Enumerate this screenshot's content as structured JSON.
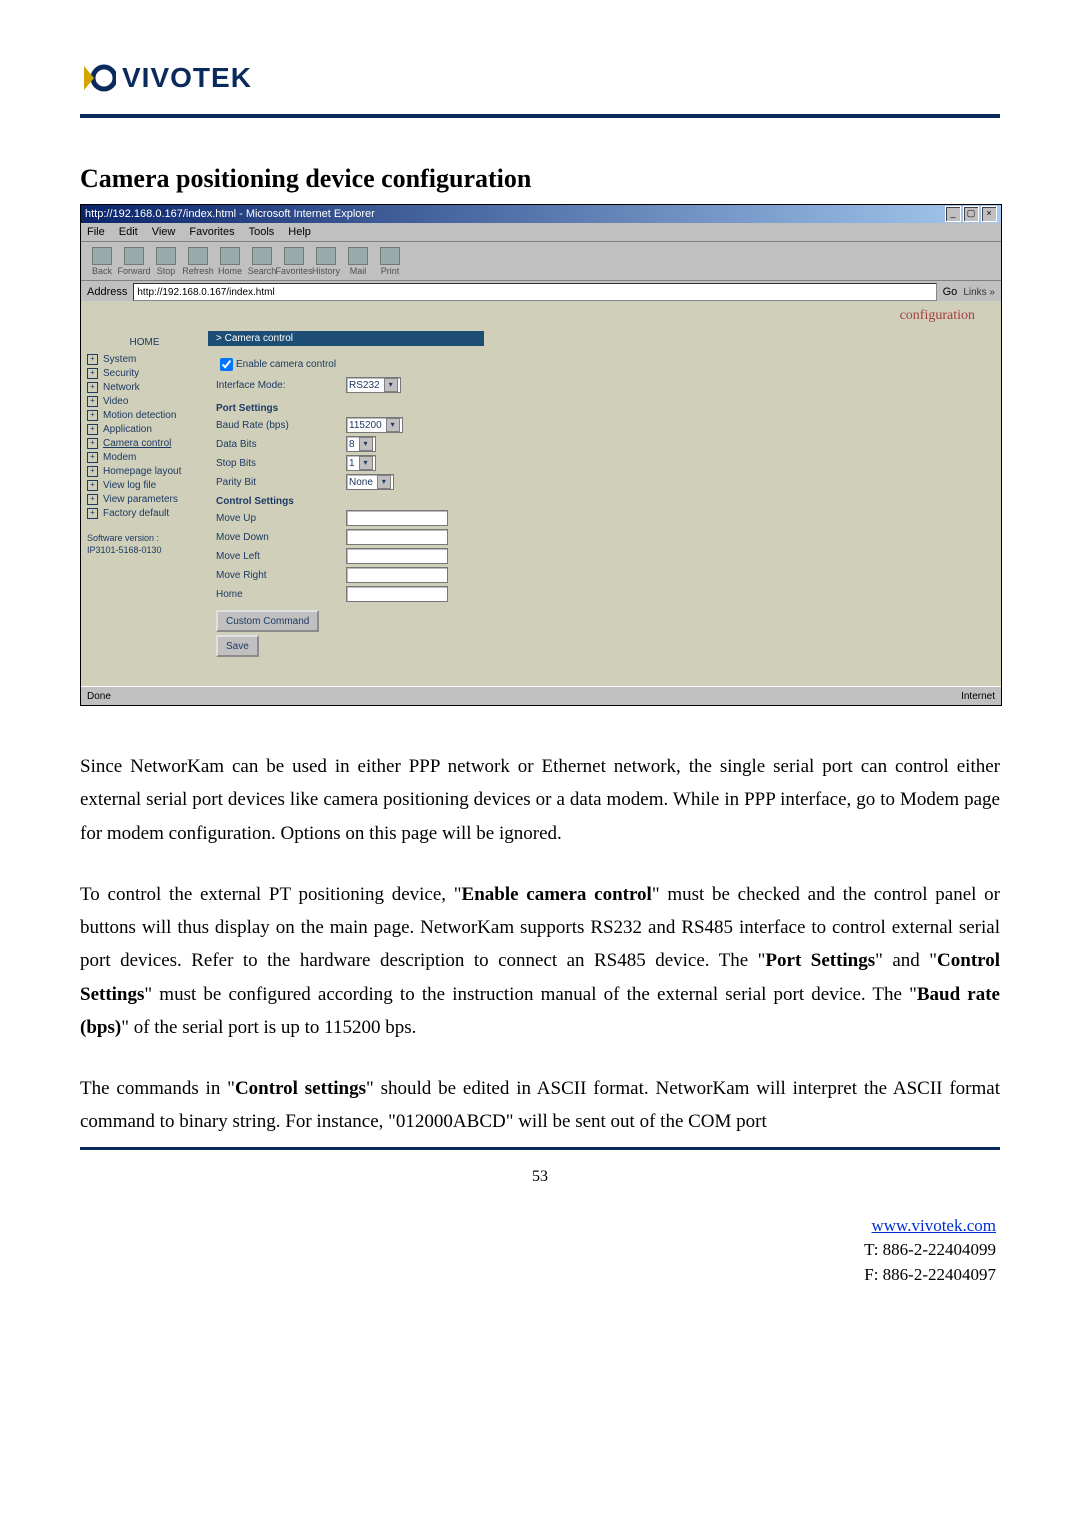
{
  "logo_text": "VIVOTEK",
  "heading": "Camera positioning device configuration",
  "ie": {
    "title": "http://192.168.0.167/index.html - Microsoft Internet Explorer",
    "menu": {
      "file": "File",
      "edit": "Edit",
      "view": "View",
      "favorites": "Favorites",
      "tools": "Tools",
      "help": "Help"
    },
    "toolbar": {
      "back": "Back",
      "forward": "Forward",
      "stop": "Stop",
      "refresh": "Refresh",
      "home": "Home",
      "search": "Search",
      "favorites": "Favorites",
      "history": "History",
      "mail": "Mail",
      "print": "Print"
    },
    "address_label": "Address",
    "address_value": "http://192.168.0.167/index.html",
    "go": "Go",
    "links": "Links »",
    "status_left": "Done",
    "status_right": "Internet"
  },
  "conf": {
    "page_label": "configuration",
    "sidebar": {
      "home": "HOME",
      "items": [
        "System",
        "Security",
        "Network",
        "Video",
        "Motion detection",
        "Application",
        "Camera control",
        "Modem",
        "Homepage layout",
        "View log file",
        "View parameters",
        "Factory default"
      ],
      "sw1": "Software version :",
      "sw2": "IP3101-5168-0130"
    },
    "panel": {
      "title": "> Camera control",
      "enable": "Enable camera control",
      "iface_label": "Interface Mode:",
      "iface_value": "RS232",
      "port_heading": "Port Settings",
      "baud_label": "Baud Rate (bps)",
      "baud_value": "115200",
      "data_label": "Data Bits",
      "data_value": "8",
      "stop_label": "Stop Bits",
      "stop_value": "1",
      "parity_label": "Parity Bit",
      "parity_value": "None",
      "ctrl_heading": "Control Settings",
      "mu": "Move Up",
      "md": "Move Down",
      "ml": "Move Left",
      "mr": "Move Right",
      "home_cmd": "Home",
      "custom_btn": "Custom Command",
      "save_btn": "Save"
    }
  },
  "paragraphs": {
    "p1": "Since NetworKam can be used in either PPP network or Ethernet network, the single serial port can control either external serial port devices like camera positioning devices or a data modem. While in PPP interface, go to Modem page for modem configuration. Options on this page will be ignored.",
    "p2a": "To control the external PT positioning device, \"",
    "p2b": "Enable camera control",
    "p2c": "\" must be checked and the control panel or buttons will thus display on the main page. NetworKam supports RS232 and RS485 interface to control external serial port devices. Refer to the hardware description to connect an RS485 device. The \"",
    "p2d": "Port Settings",
    "p2e": "\" and \"",
    "p2f": "Control Settings",
    "p2g": "\" must be configured according to the instruction manual of the external serial port device. The \"",
    "p2h": "Baud rate (bps)",
    "p2i": "\" of the serial port is up to 115200 bps.",
    "p3a": "The commands in \"",
    "p3b": "Control settings",
    "p3c": "\" should be edited in ASCII format. NetworKam will interpret the ASCII format command to binary string. For instance, \"012000ABCD\" will be sent out of the COM port"
  },
  "page_number": "53",
  "footer": {
    "url": "www.vivotek.com",
    "tel": "T: 886-2-22404099",
    "fax": "F: 886-2-22404097"
  }
}
